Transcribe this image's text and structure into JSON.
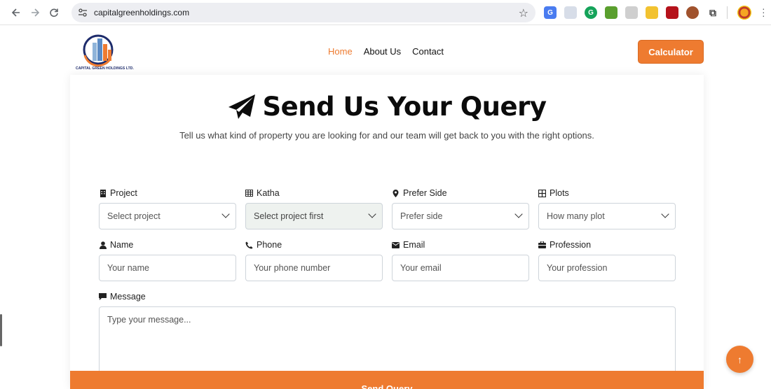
{
  "browser": {
    "url": "capitalgreenholdings.com",
    "back_icon": "arrow-left-icon",
    "forward_icon": "arrow-right-icon",
    "reload_icon": "reload-icon"
  },
  "header": {
    "logo_text": "CAPITAL GREEN HOLDINGS LTD.",
    "nav": {
      "home": "Home",
      "about": "About Us",
      "contact": "Contact"
    },
    "calculator_label": "Calculator"
  },
  "form": {
    "title": "Send Us Your Query",
    "subtitle": "Tell us what kind of property you are looking for and our team will get back to you with the right options.",
    "project": {
      "label": "Project",
      "value": "Select project"
    },
    "katha": {
      "label": "Katha",
      "value": "Select project first"
    },
    "prefer_side": {
      "label": "Prefer Side",
      "value": "Prefer side"
    },
    "plots": {
      "label": "Plots",
      "value": "How many plot"
    },
    "name": {
      "label": "Name",
      "placeholder": "Your name"
    },
    "phone": {
      "label": "Phone",
      "placeholder": "Your phone number"
    },
    "email": {
      "label": "Email",
      "placeholder": "Your email"
    },
    "profession": {
      "label": "Profession",
      "placeholder": "Your profession"
    },
    "message": {
      "label": "Message",
      "placeholder": "Type your message..."
    },
    "submit_label": "Send Query"
  },
  "colors": {
    "accent": "#ee7b30",
    "nav_active": "#ee7b30"
  }
}
